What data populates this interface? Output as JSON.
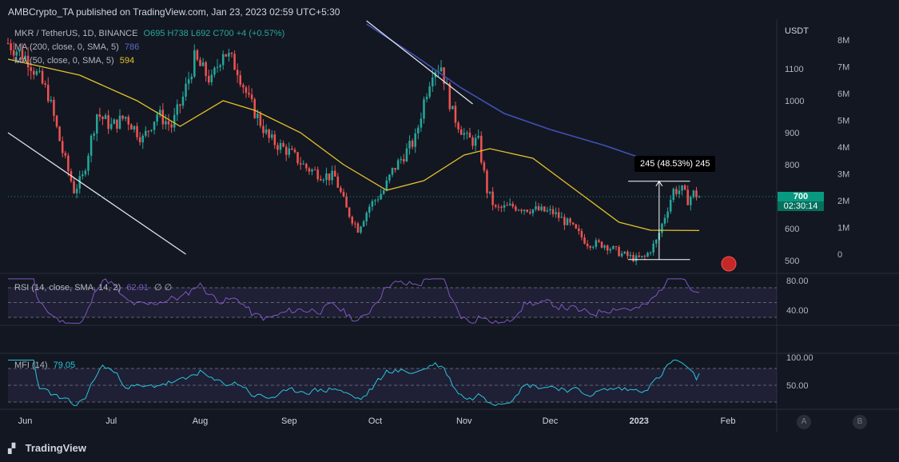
{
  "header": "AMBCrypto_TA published on TradingView.com, Jan 23, 2023 02:59 UTC+5:30",
  "footer": {
    "brand": "TradingView",
    "logo_icon": "tradingview-logo-icon"
  },
  "colors": {
    "background": "#131722",
    "up_candle": "#26a69a",
    "down_candle": "#ef5350",
    "ma200": "#3f51b5",
    "ma50": "#e6c229",
    "rsi": "#7e57c2",
    "mfi": "#26c6da",
    "price_tag": "#089981"
  },
  "main": {
    "legend": {
      "symbol": "MKR / TetherUS, 1D, BINANCE",
      "ohlc": "O695 H738 L692 C700 +4 (+0.57%)",
      "ma200_label": "MA (200, close, 0, SMA, 5)",
      "ma200_value": "786",
      "ma50_label": "MA (50, close, 0, SMA, 5)",
      "ma50_value": "594"
    },
    "price_tag": {
      "price": "700",
      "countdown": "02:30:14"
    },
    "measure_label": "245 (48.53%) 245",
    "currency": "USDT"
  },
  "rsi_panel": {
    "legend": "RSI (14, close, SMA, 14, 2)",
    "value": "62.91",
    "extra": "∅ ∅",
    "ticks": [
      "80.00",
      "40.00"
    ]
  },
  "mfi_panel": {
    "legend": "MFI (14)",
    "value": "79.05",
    "ticks": [
      "100.00",
      "50.00"
    ]
  },
  "buttons": {
    "a": "A",
    "b": "B"
  },
  "chart_data": {
    "type": "candlestick",
    "title": "MKR / TetherUS, 1D, BINANCE",
    "ylabel": "USDT",
    "ylim": [
      470,
      1250
    ],
    "yticks": [
      500,
      600,
      700,
      800,
      900,
      1000,
      1100
    ],
    "volume_ticks": [
      "0",
      "1M",
      "2M",
      "3M",
      "4M",
      "5M",
      "6M",
      "7M",
      "8M"
    ],
    "x_tick_labels": [
      "Jun",
      "Jul",
      "Aug",
      "Sep",
      "Oct",
      "Nov",
      "Dec",
      "2023",
      "Feb"
    ],
    "price_keypoints": [
      [
        "2022-05-26",
        1180
      ],
      [
        "2022-06-02",
        1130
      ],
      [
        "2022-06-09",
        1020
      ],
      [
        "2022-06-14",
        840
      ],
      [
        "2022-06-18",
        720
      ],
      [
        "2022-06-21",
        760
      ],
      [
        "2022-06-26",
        960
      ],
      [
        "2022-07-01",
        920
      ],
      [
        "2022-07-06",
        950
      ],
      [
        "2022-07-12",
        880
      ],
      [
        "2022-07-17",
        960
      ],
      [
        "2022-07-22",
        920
      ],
      [
        "2022-07-26",
        1010
      ],
      [
        "2022-07-30",
        1130
      ],
      [
        "2022-08-05",
        1060
      ],
      [
        "2022-08-09",
        1160
      ],
      [
        "2022-08-14",
        1100
      ],
      [
        "2022-08-18",
        1000
      ],
      [
        "2022-08-25",
        880
      ],
      [
        "2022-09-01",
        840
      ],
      [
        "2022-09-07",
        790
      ],
      [
        "2022-09-12",
        770
      ],
      [
        "2022-09-17",
        760
      ],
      [
        "2022-09-21",
        660
      ],
      [
        "2022-09-25",
        600
      ],
      [
        "2022-09-29",
        670
      ],
      [
        "2022-10-04",
        720
      ],
      [
        "2022-10-07",
        780
      ],
      [
        "2022-10-11",
        830
      ],
      [
        "2022-10-15",
        880
      ],
      [
        "2022-10-18",
        1000
      ],
      [
        "2022-10-21",
        1100
      ],
      [
        "2022-10-24",
        1110
      ],
      [
        "2022-10-28",
        960
      ],
      [
        "2022-11-02",
        880
      ],
      [
        "2022-11-06",
        870
      ],
      [
        "2022-11-09",
        720
      ],
      [
        "2022-11-12",
        660
      ],
      [
        "2022-11-18",
        670
      ],
      [
        "2022-11-25",
        660
      ],
      [
        "2022-12-02",
        650
      ],
      [
        "2022-12-08",
        610
      ],
      [
        "2022-12-14",
        555
      ],
      [
        "2022-12-20",
        550
      ],
      [
        "2022-12-26",
        520
      ],
      [
        "2022-12-31",
        505
      ],
      [
        "2023-01-03",
        510
      ],
      [
        "2023-01-07",
        560
      ],
      [
        "2023-01-10",
        640
      ],
      [
        "2023-01-13",
        720
      ],
      [
        "2023-01-16",
        720
      ],
      [
        "2023-01-18",
        690
      ],
      [
        "2023-01-20",
        710
      ],
      [
        "2023-01-22",
        700
      ]
    ],
    "ma50": [
      [
        "2022-05-26",
        1130
      ],
      [
        "2022-06-20",
        1080
      ],
      [
        "2022-07-10",
        1000
      ],
      [
        "2022-07-25",
        920
      ],
      [
        "2022-08-09",
        1000
      ],
      [
        "2022-08-20",
        970
      ],
      [
        "2022-09-05",
        900
      ],
      [
        "2022-09-20",
        800
      ],
      [
        "2022-10-05",
        720
      ],
      [
        "2022-10-18",
        750
      ],
      [
        "2022-11-01",
        830
      ],
      [
        "2022-11-10",
        850
      ],
      [
        "2022-11-25",
        820
      ],
      [
        "2022-12-10",
        720
      ],
      [
        "2022-12-25",
        620
      ],
      [
        "2023-01-05",
        595
      ],
      [
        "2023-01-22",
        594
      ]
    ],
    "ma200": [
      [
        "2022-09-28",
        1240
      ],
      [
        "2022-10-15",
        1140
      ],
      [
        "2022-10-31",
        1040
      ],
      [
        "2022-11-15",
        960
      ],
      [
        "2022-12-01",
        910
      ],
      [
        "2022-12-20",
        860
      ],
      [
        "2023-01-02",
        820
      ]
    ],
    "trendlines": [
      {
        "from": [
          "2022-05-26",
          900
        ],
        "to": [
          "2022-07-27",
          520
        ]
      },
      {
        "from": [
          "2022-09-28",
          1250
        ],
        "to": [
          "2022-11-04",
          990
        ]
      }
    ],
    "measurement": {
      "from": [
        "2022-12-31",
        503
      ],
      "to": [
        "2023-01-16",
        748
      ],
      "label": "245 (48.53%) 245"
    },
    "current_price": 700,
    "rsi_last": 62.91,
    "mfi_last": 79.05
  }
}
